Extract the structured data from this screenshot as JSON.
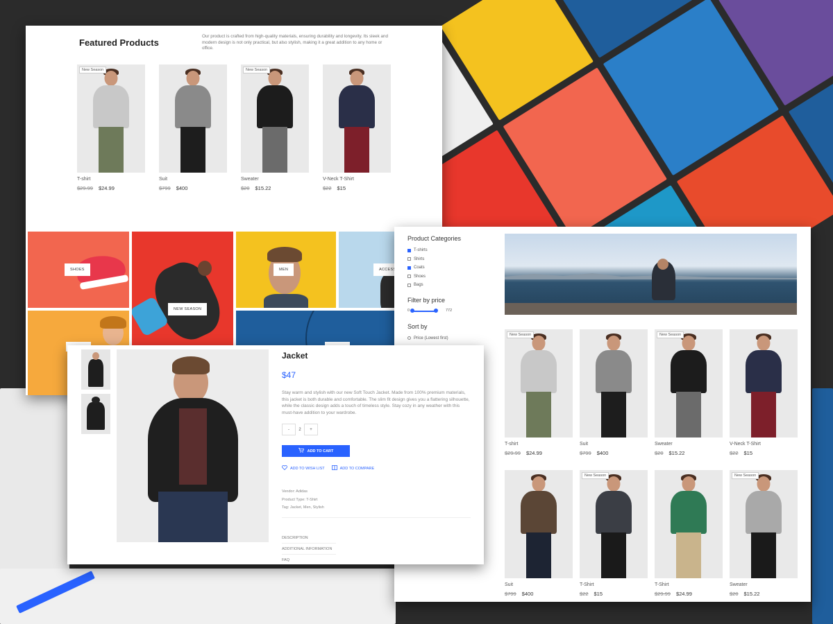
{
  "featured": {
    "title": "Featured Products",
    "description": "Our product is crafted from high-quality materials, ensuring durability and longevity. Its sleek and modern design is not only practical, but also stylish, making it a great addition to any home or office.",
    "products": [
      {
        "name": "T-shirt",
        "old_price": "$29.99",
        "price": "$24.99",
        "badge": "New Season",
        "shirt": "#c8c8c8",
        "pants": "#6e7a5a"
      },
      {
        "name": "Suit",
        "old_price": "$799",
        "price": "$400",
        "badge": "",
        "shirt": "#8a8a8a",
        "pants": "#1d1d1d"
      },
      {
        "name": "Sweater",
        "old_price": "$20",
        "price": "$15.22",
        "badge": "New Season",
        "shirt": "#1c1c1c",
        "pants": "#6b6b6b"
      },
      {
        "name": "V-Neck T-Shirt",
        "old_price": "$22",
        "price": "$15",
        "badge": "",
        "shirt": "#2a2f48",
        "pants": "#7d1f2a"
      }
    ]
  },
  "categories": {
    "shoes": "SHOES",
    "new_season": "NEW SEASON",
    "men": "MEN",
    "accessories": "ACCESSO"
  },
  "shop": {
    "categories_title": "Product Categories",
    "categories": [
      {
        "label": "T-shirts",
        "checked": true
      },
      {
        "label": "Shirts",
        "checked": false
      },
      {
        "label": "Coats",
        "checked": true
      },
      {
        "label": "Shoes",
        "checked": false
      },
      {
        "label": "Bags",
        "checked": false
      }
    ],
    "filter_title": "Filter by price",
    "price_min": "0",
    "price_max": "772",
    "sort_title": "Sort by",
    "sort_option": "Price (Lowest first)",
    "products": [
      {
        "name": "T-shirt",
        "old_price": "$29.99",
        "price": "$24.99",
        "badge": "New Season",
        "shirt": "#c8c8c8",
        "pants": "#6e7a5a"
      },
      {
        "name": "Suit",
        "old_price": "$799",
        "price": "$400",
        "badge": "",
        "shirt": "#8a8a8a",
        "pants": "#1d1d1d"
      },
      {
        "name": "Sweater",
        "old_price": "$20",
        "price": "$15.22",
        "badge": "New Season",
        "shirt": "#1c1c1c",
        "pants": "#6b6b6b"
      },
      {
        "name": "V-Neck T-Shirt",
        "old_price": "$22",
        "price": "$15",
        "badge": "",
        "shirt": "#2a2f48",
        "pants": "#7d1f2a"
      },
      {
        "name": "Suit",
        "old_price": "$799",
        "price": "$400",
        "badge": "",
        "shirt": "#5b4636",
        "pants": "#1d2433"
      },
      {
        "name": "T-Shirt",
        "old_price": "$22",
        "price": "$15",
        "badge": "New Season",
        "shirt": "#3b3e45",
        "pants": "#1a1a1a"
      },
      {
        "name": "T-Shirt",
        "old_price": "$29.99",
        "price": "$24.99",
        "badge": "",
        "shirt": "#2f7a55",
        "pants": "#c9b48c"
      },
      {
        "name": "Sweater",
        "old_price": "$20",
        "price": "$15.22",
        "badge": "New Season",
        "shirt": "#a9a9a9",
        "pants": "#1a1a1a"
      }
    ]
  },
  "detail": {
    "title": "Jacket",
    "price": "$47",
    "description": "Stay warm and stylish with our new Soft Touch Jacket. Made from 100% premium materials, this jacket is both durable and comfortable. The slim fit design gives you a flattering silhouette, while the classic design adds a touch of timeless style. Stay cozy in any weather with this must-have addition to your wardrobe.",
    "qty_minus": "-",
    "qty_value": "2",
    "qty_plus": "+",
    "add_to_cart": "ADD TO CART",
    "wishlist": "ADD TO WISH LIST",
    "compare": "ADD TO COMPARE",
    "vendor": "Vendor: Adidas",
    "product_type": "Product Type: T-Shirt",
    "tags": "Tag: Jacket, Men, Stylish",
    "tabs": [
      "DESCRIPTION",
      "ADDITIONAL INFORMATION",
      "FAQ"
    ]
  },
  "colors": {
    "accent": "#2962ff",
    "shoes_bg": "#f2664f",
    "new_season_bg": "#e8372c",
    "men_bg": "#f4c21f",
    "accessories_bg": "#b9d8ec",
    "kids_bg": "#f6a93d",
    "blue_tile": "#1f5e9c"
  }
}
